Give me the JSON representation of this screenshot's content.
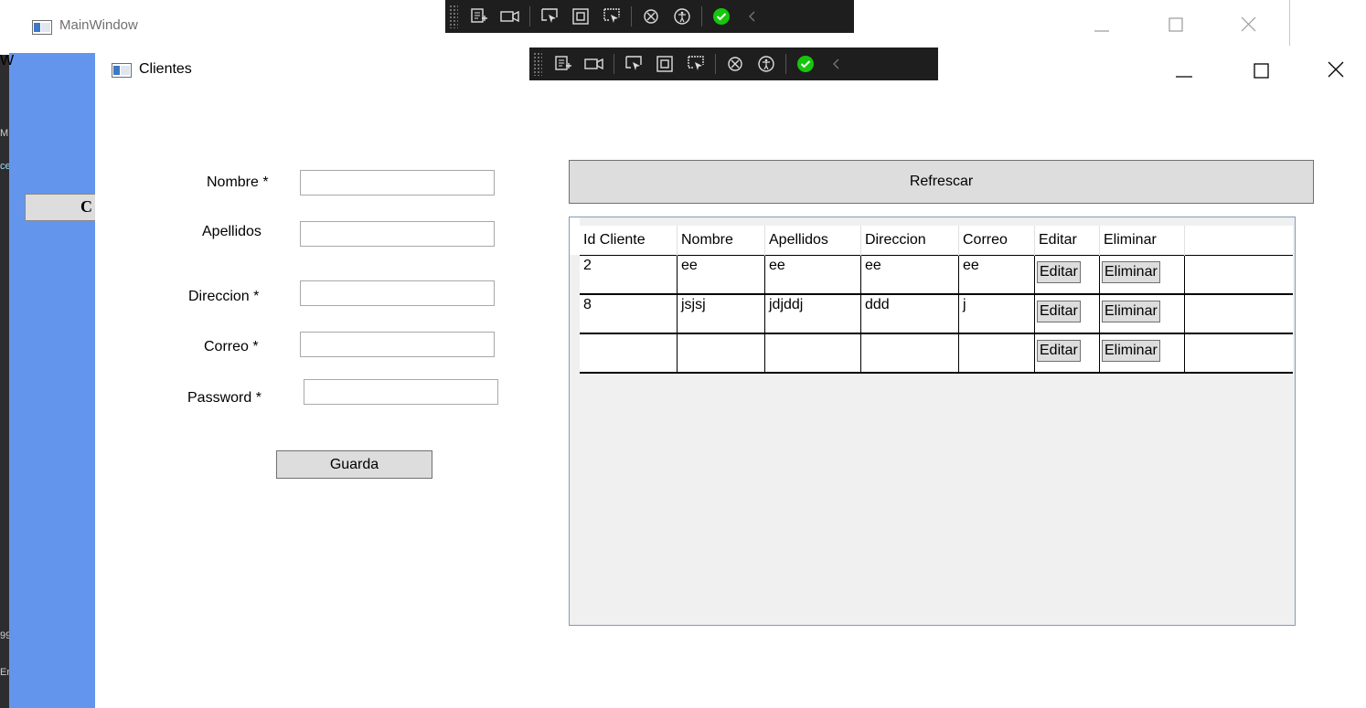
{
  "main_window": {
    "title": "MainWindow",
    "stray_left_text": "W",
    "blue_button_label": "C"
  },
  "ide_strip": {
    "fragments": [
      "M",
      "ce",
      "99",
      "Er"
    ]
  },
  "clientes_window": {
    "title": "Clientes"
  },
  "form": {
    "fields": [
      {
        "label": "Nombre *",
        "value": ""
      },
      {
        "label": "Apellidos",
        "value": ""
      },
      {
        "label": "Direccion *",
        "value": ""
      },
      {
        "label": "Correo *",
        "value": ""
      },
      {
        "label": "Password *",
        "value": ""
      }
    ],
    "save_label": "Guarda"
  },
  "refresh_label": "Refrescar",
  "grid": {
    "columns": [
      "Id Cliente",
      "Nombre",
      "Apellidos",
      "Direccion",
      "Correo",
      "Editar",
      "Eliminar"
    ],
    "rows": [
      {
        "id": "2",
        "nombre": "ee",
        "apellidos": "ee",
        "direccion": "ee",
        "correo": "ee",
        "edit_label": "Editar",
        "delete_label": "Eliminar"
      },
      {
        "id": "8",
        "nombre": "jsjsj",
        "apellidos": "jdjddj",
        "direccion": "ddd",
        "correo": "j",
        "edit_label": "Editar",
        "delete_label": "Eliminar"
      },
      {
        "id": "",
        "nombre": "",
        "apellidos": "",
        "direccion": "",
        "correo": "",
        "edit_label": "Editar",
        "delete_label": "Eliminar"
      }
    ]
  },
  "icons": {
    "window": "window-icon",
    "minimize": "minimize-icon",
    "maximize": "maximize-icon",
    "close": "close-icon",
    "toolbar": [
      "live-visual-tree-icon",
      "record-icon",
      "select-element-icon",
      "display-adorners-icon",
      "track-focus-icon",
      "hot-reload-icon",
      "accessibility-icon",
      "binding-ok-icon",
      "collapse-chevron-icon"
    ]
  },
  "colors": {
    "main_background": "#6495ed",
    "button_face": "#dddddd",
    "grid_background": "#f0f0f0",
    "grid_border": "#7f9db9",
    "toolbar_background": "#1e1e1e",
    "status_ok": "#16c60c"
  }
}
